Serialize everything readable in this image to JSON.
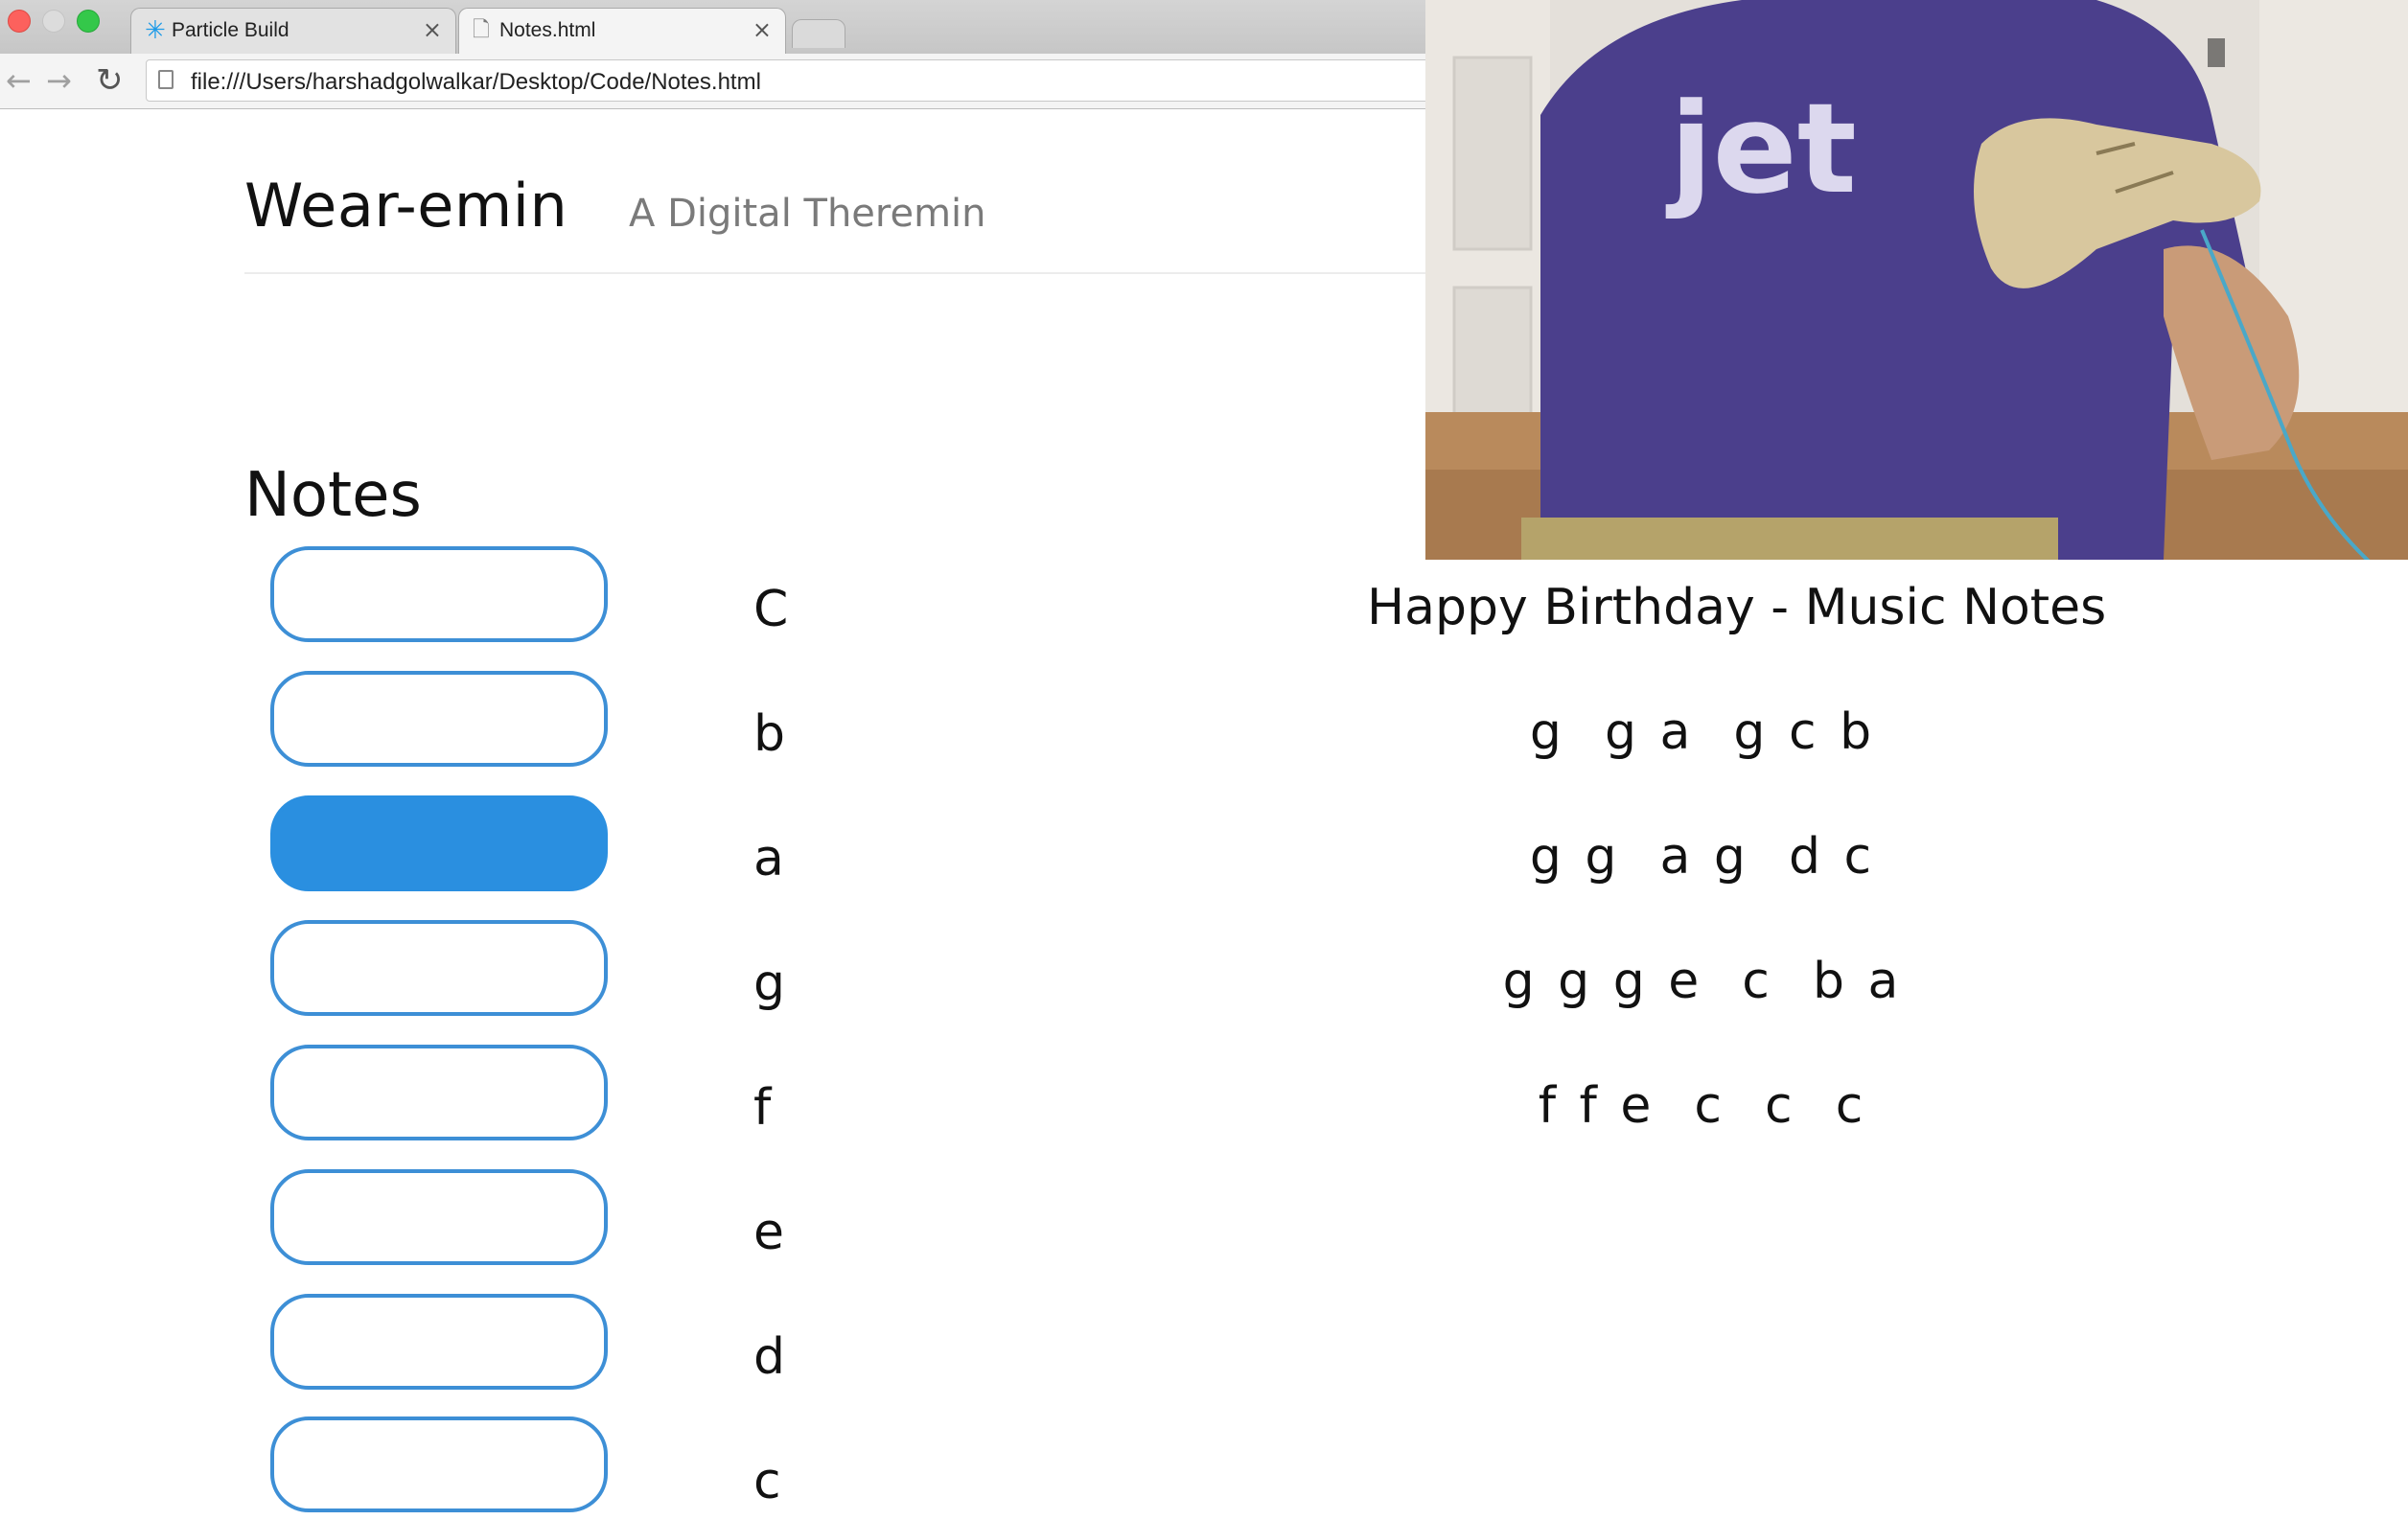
{
  "browser": {
    "tabs": [
      {
        "title": "Particle Build",
        "icon": "particle-star-icon",
        "close": "×",
        "active": false
      },
      {
        "title": "Notes.html",
        "icon": "page-icon",
        "close": "×",
        "active": true
      }
    ],
    "url": "file:///Users/harshadgolwalkar/Desktop/Code/Notes.html",
    "nav": {
      "back": "←",
      "forward": "→",
      "reload": "↻"
    }
  },
  "header": {
    "title": "Wear-emin",
    "subtitle": "A Digital Theremin"
  },
  "notes_section": {
    "title": "Notes",
    "notes": [
      {
        "label": "C",
        "active": false
      },
      {
        "label": "b",
        "active": false
      },
      {
        "label": "a",
        "active": true
      },
      {
        "label": "g",
        "active": false
      },
      {
        "label": "f",
        "active": false
      },
      {
        "label": "e",
        "active": false
      },
      {
        "label": "d",
        "active": false
      },
      {
        "label": "c",
        "active": false
      }
    ]
  },
  "song": {
    "title": "Happy Birthday - Music Notes",
    "lines": [
      "g  g a  g c b",
      "g g  a g  d c",
      "g g g e  c  b a",
      "f f e  c  c  c"
    ]
  },
  "webcam": {
    "shirt_text": "jet"
  },
  "colors": {
    "accent": "#2a8fe0",
    "button_border": "#3d8fd6",
    "shirt": "#4b3f8c"
  }
}
